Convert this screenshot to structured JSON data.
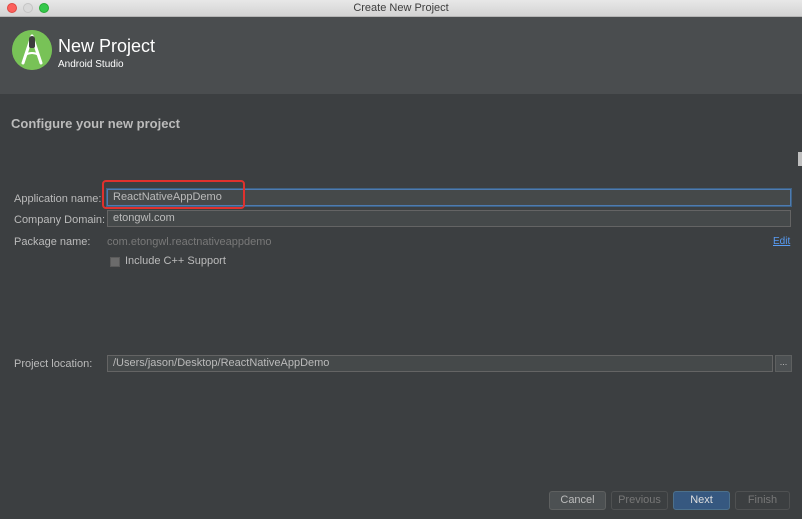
{
  "window": {
    "title": "Create New Project"
  },
  "header": {
    "title": "New Project",
    "subtitle": "Android Studio",
    "logo_icon": "android-studio-logo-icon"
  },
  "section_title": "Configure your new project",
  "form": {
    "app_name_label": "Application name:",
    "app_name_value": "ReactNativeAppDemo",
    "company_domain_label": "Company Domain:",
    "company_domain_value": "etongwl.com",
    "package_name_label": "Package name:",
    "package_name_value": "com.etongwl.reactnativeappdemo",
    "edit_link": "Edit",
    "include_cpp_label": "Include C++ Support",
    "include_cpp_checked": false,
    "project_location_label": "Project location:",
    "project_location_value": "/Users/jason/Desktop/ReactNativeAppDemo",
    "browse_label": "..."
  },
  "buttons": {
    "cancel": "Cancel",
    "previous": "Previous",
    "next": "Next",
    "finish": "Finish"
  },
  "colors": {
    "highlight": "#e0312d",
    "accent_blue": "#589df6",
    "logo_green": "#78c257"
  }
}
